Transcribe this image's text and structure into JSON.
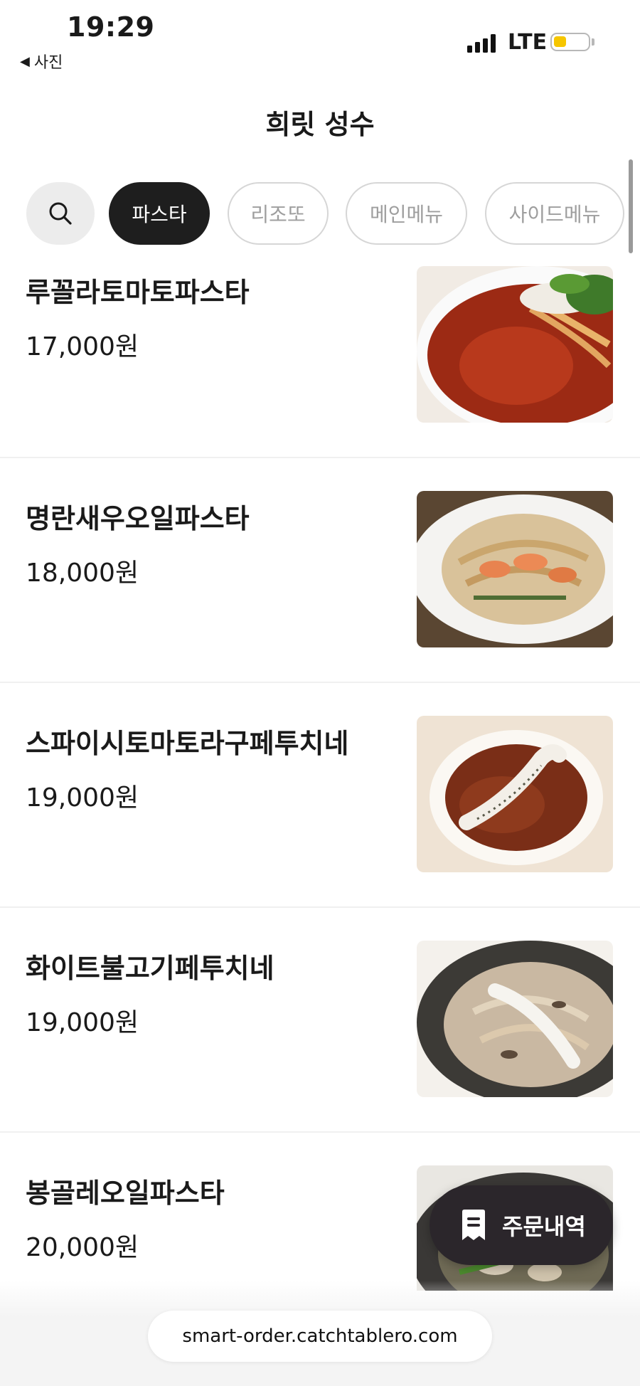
{
  "status_bar": {
    "time": "19:29",
    "back_label": "사진",
    "network": "LTE",
    "battery_level": 0.3,
    "battery_color": "#f6c600"
  },
  "header": {
    "title": "희릿 성수"
  },
  "categories": {
    "search_icon": "search-icon",
    "tabs": [
      {
        "label": "파스타",
        "active": true
      },
      {
        "label": "리조또",
        "active": false
      },
      {
        "label": "메인메뉴",
        "active": false
      },
      {
        "label": "사이드메뉴",
        "active": false
      }
    ]
  },
  "menu": {
    "items": [
      {
        "name": "루꼴라토마토파스타",
        "price": "17,000원"
      },
      {
        "name": "명란새우오일파스타",
        "price": "18,000원"
      },
      {
        "name": "스파이시토마토라구페투치네",
        "price": "19,000원"
      },
      {
        "name": "화이트불고기페투치네",
        "price": "19,000원"
      },
      {
        "name": "봉골레오일파스타",
        "price": "20,000원"
      }
    ]
  },
  "order_history": {
    "label": "주문내역",
    "icon": "receipt-icon"
  },
  "browser": {
    "url": "smart-order.catchtablero.com"
  },
  "colors": {
    "active_chip": "#1e1e1e",
    "order_button": "#2b262b",
    "inactive_chip_text": "#9e9e9e"
  }
}
